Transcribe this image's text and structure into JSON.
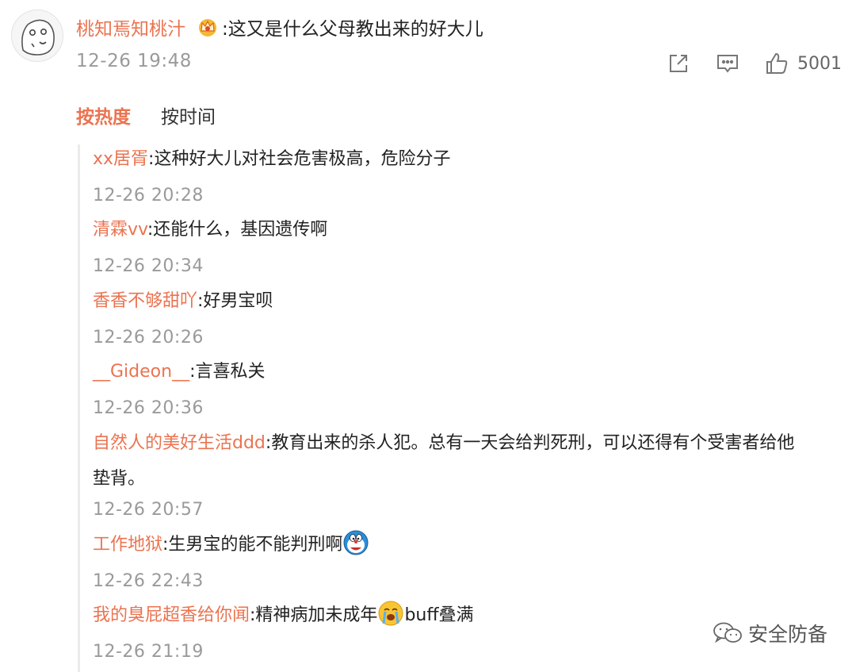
{
  "comment": {
    "username": "桃知焉知桃汁",
    "text": ":这又是什么父母教出来的好大儿",
    "time": "12-26 19:48",
    "like_count": "5001"
  },
  "icons": {
    "share": "share-icon",
    "comment": "comment-icon",
    "like": "thumbs-up-icon",
    "crown": "crown-badge-icon"
  },
  "sort_tabs": [
    {
      "label": "按热度",
      "active": true
    },
    {
      "label": "按时间",
      "active": false
    }
  ],
  "replies": [
    {
      "name": "xx居胥",
      "text": ":这种好大儿对社会危害极高，危险分子",
      "time": "12-26 20:28"
    },
    {
      "name": "清霖vv",
      "text": ":还能什么，基因遗传啊",
      "time": "12-26 20:34"
    },
    {
      "name": "香香不够甜吖",
      "text": ":好男宝呗",
      "time": "12-26 20:26"
    },
    {
      "name": "__Gideon__",
      "text": ":言喜私关",
      "time": "12-26 20:36"
    },
    {
      "name": "自然人的美好生活ddd",
      "text": ":教育出来的杀人犯。总有一天会给判死刑，可以还得有个受害者给他",
      "text2": "垫背。",
      "time": "12-26 20:57"
    },
    {
      "name": "工作地狱",
      "text": ":生男宝的能不能判刑啊",
      "time": "12-26 22:43",
      "emoji": "doraemon-emoji-icon"
    },
    {
      "name": "我的臭屁超香给你闻",
      "text": ":精神病加未成年",
      "text2": "buff叠满",
      "time": "12-26 21:19",
      "emoji": "crying-face-emoji-icon"
    }
  ],
  "watermark": {
    "text": "安全防备",
    "icon": "wechat-icon"
  },
  "colors": {
    "username": "#eb7350",
    "timestamp": "#9a9a9a",
    "text": "#222222"
  }
}
